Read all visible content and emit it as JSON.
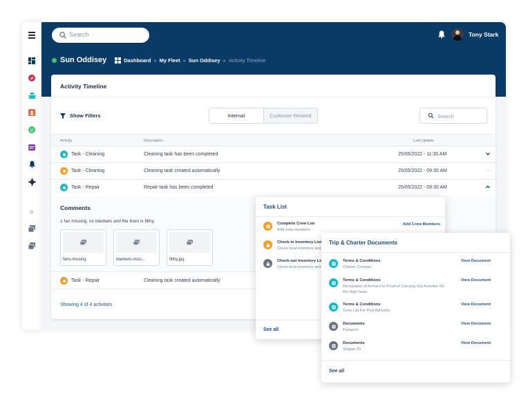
{
  "colors": {
    "navy": "#0a3a66",
    "online": "#3dc36c",
    "teal": "#1ab8c9",
    "orange": "#f4a024",
    "grey": "#6b7280",
    "link": "#27548a"
  },
  "rail": {
    "icons": [
      "menu-icon",
      "dashboard-icon",
      "check-badge-icon",
      "ship-icon",
      "crew-icon",
      "smiley-icon",
      "calendar-icon",
      "bell-icon",
      "settings-icon",
      "letter-d-icon",
      "documents-icon",
      "documents-alt-icon"
    ],
    "letter": "D"
  },
  "header": {
    "search_placeholder": "Search",
    "user_name": "Tony Stark"
  },
  "breadcrumb": {
    "vessel": "Sun Oddisey",
    "items": [
      "Dashboard",
      "My Fleet",
      "Sun Oddisey",
      "Activity Timeline"
    ],
    "separator": "»"
  },
  "timeline": {
    "title": "Activity Timeline",
    "show_filters": "Show Filters",
    "tabs": [
      "Internal",
      "Customer Related"
    ],
    "active_tab": "Internal",
    "search_placeholder": "Search",
    "columns": [
      "Activity",
      "Description",
      "Last Update"
    ],
    "rows": [
      {
        "activity": "Task - Cleaning",
        "description": "Cleaning task has been completed",
        "date": "25/05/2022 - 11:30 AM",
        "status": "teal"
      },
      {
        "activity": "Task - Cleaning",
        "description": "Cleaning task created automatically",
        "date": "25/05/2022 - 09:30 AM",
        "status": "orange"
      },
      {
        "activity": "Task - Repair",
        "description": "Repair task has been completed",
        "date": "25/05/2022 - 09:30 AM",
        "status": "teal"
      },
      {
        "activity": "Task - Repair",
        "description": "Cleaning task created automatically",
        "date": "",
        "status": "orange"
      }
    ],
    "comments": {
      "title": "Comments",
      "text": "1 fan missing, no blankets and the linen is filthy.",
      "attachments": [
        "fans-missing",
        "blankets-miss...",
        "filthy.jpg"
      ]
    },
    "footer": "Showing 4 of 4 activities"
  },
  "task_list": {
    "title": "Task List",
    "items": [
      {
        "title": "Complete Crew List",
        "subtitle": "Add crew members",
        "action": "Add Crew Members",
        "status": "orange"
      },
      {
        "title": "Check-in Inventory List",
        "subtitle": "Check boat inventory and u",
        "status": "orange"
      },
      {
        "title": "Check-out Inventory List",
        "subtitle": "Check boat inventory and u",
        "status": "grey"
      }
    ],
    "see_all": "See all"
  },
  "documents": {
    "title": "Trip & Charter Documents",
    "items": [
      {
        "title": "Terms & Conditions",
        "lines": [
          "Charter Contract"
        ],
        "action": "View Document",
        "status": "teal"
      },
      {
        "title": "Terms & Conditions",
        "lines": [
          "Declaration of Arrival For Proof of Carrying Out Activites On",
          "the High Seas"
        ],
        "action": "View Document",
        "status": "teal"
      },
      {
        "title": "Terms & Conditions",
        "lines": [
          "Crew List For Port Authority"
        ],
        "action": "View Document",
        "status": "teal"
      },
      {
        "title": "Documents",
        "lines": [
          "Passport"
        ],
        "action": "View Document",
        "status": "grey"
      },
      {
        "title": "Documents",
        "lines": [
          "Skipper ID"
        ],
        "action": "View Document",
        "status": "grey"
      }
    ],
    "see_all": "See all"
  }
}
